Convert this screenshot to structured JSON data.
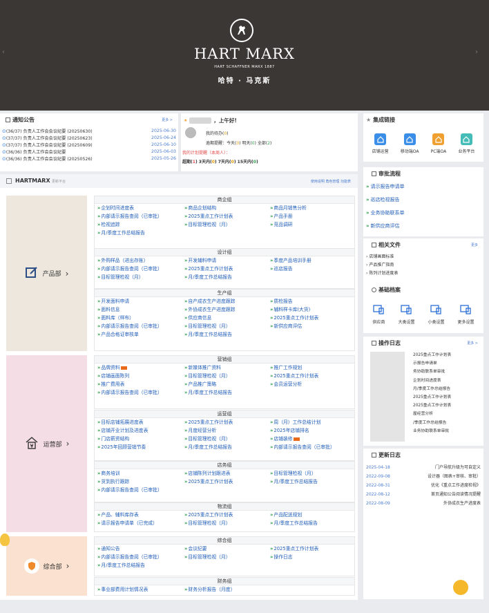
{
  "banner": {
    "brand": "HART MARX",
    "sub": "HART SCHAFFNER MARX 1887",
    "cn": "哈特 · 马克斯",
    "prev_glyph": "‹",
    "next_glyph": "›"
  },
  "notices": {
    "title": "通知公告",
    "more": "更多 >",
    "rows": [
      {
        "text": "(36/37) 负责人工作会会议纪要 (20250630)",
        "date": "2025-06-30"
      },
      {
        "text": "(37/37) 负责人工作会会议纪要 (20250623)",
        "date": "2025-06-24"
      },
      {
        "text": "(37/37) 负责人工作会会议纪要 (20250609)",
        "date": "2025-06-10"
      },
      {
        "text": "(36/36) 负责人工作会会议纪要",
        "date": "2025-06-03"
      },
      {
        "text": "(36/36) 负责人工作会会议纪要 (20250526)",
        "date": "2025-05-26"
      }
    ]
  },
  "greeting": {
    "salute": "，上午好!",
    "my_todo": "我的待办(",
    "my_todo_n": "0",
    "late_label": "逾期提醒：今天(",
    "today": "0",
    "tomorrow_label": ") 明天(",
    "tomorrow": "0",
    "all_label": ") 全部(",
    "all": "2",
    "close": ")",
    "plan_label": "我的计划提醒（本周人）：",
    "overdue_label": "超期(",
    "overdue": "1",
    "d3_label": ") 3天内(",
    "d3": "0",
    "d7_label": ") 7天内(",
    "d7": "0",
    "d15_label": ") 15天内(",
    "d15": "0"
  },
  "hartmarx": {
    "title": "HARTMARX",
    "sub": "更新平台",
    "links": "使用说明  角色管理  功能表"
  },
  "groups": {
    "product": {
      "dept": "产品部",
      "sections": [
        {
          "name": "商企组",
          "items": [
            {
              "t": "企划时间进度表"
            },
            {
              "t": "商品企划结构"
            },
            {
              "t": "商品月销售分析"
            },
            {
              "t": "内部请示报告查阅（已审批）"
            },
            {
              "t": "2025重点工作计划表"
            },
            {
              "t": "产品手册"
            },
            {
              "t": "检视追踪"
            },
            {
              "t": "目标管理检视（月）"
            },
            {
              "t": "竞品调研"
            },
            {
              "t": "月/季度工作总结报告"
            }
          ]
        },
        {
          "name": "设计组",
          "items": [
            {
              "t": "外购样品（进出存账）"
            },
            {
              "t": "开发辅料申请"
            },
            {
              "t": "季度产品培训手册"
            },
            {
              "t": "内部请示报告查阅（已审批）"
            },
            {
              "t": "2025重点工作计划表"
            },
            {
              "t": "巡店报告"
            },
            {
              "t": "目标管理检视（月）"
            },
            {
              "t": "月/季度工作总结报告"
            }
          ]
        },
        {
          "name": "生产组",
          "items": [
            {
              "t": "开发面料申请"
            },
            {
              "t": "自产成衣生产进度跟踪"
            },
            {
              "t": "质检报告"
            },
            {
              "t": "面料信息"
            },
            {
              "t": "外协成衣生产进度跟踪"
            },
            {
              "t": "辅料样卡库(大货)"
            },
            {
              "t": "面料库（样布）"
            },
            {
              "t": "供应商信息"
            },
            {
              "t": "2025重点工作计划表"
            },
            {
              "t": "内部请示报告查阅（已审批）"
            },
            {
              "t": "目标管理检视（月）"
            },
            {
              "t": "新供应商评估"
            },
            {
              "t": "产品合格证审核单"
            },
            {
              "t": "月/季度工作总结报告"
            }
          ]
        }
      ]
    },
    "ops": {
      "dept": "运营部",
      "sections": [
        {
          "name": "营销组",
          "items": [
            {
              "t": "品牌资料",
              "tag": true
            },
            {
              "t": "新媒体推广资料"
            },
            {
              "t": "推广工作规划"
            },
            {
              "t": "店铺画面陈列"
            },
            {
              "t": "目标管理检视（月）"
            },
            {
              "t": "2025重点工作计划表"
            },
            {
              "t": "推广费用表"
            },
            {
              "t": "产品推广策略"
            },
            {
              "t": "会员运营分析"
            },
            {
              "t": "内部请示报告查阅（已审批）"
            },
            {
              "t": "月/季度工作总结报告"
            }
          ]
        },
        {
          "name": "运营组",
          "items": [
            {
              "t": "目标店铺拓展进度表"
            },
            {
              "t": "2025重点工作计划表"
            },
            {
              "t": "周（月）工作总结计划"
            },
            {
              "t": "店铺开业计划及进度表"
            },
            {
              "t": "月度经营分析"
            },
            {
              "t": "2025年店铺排名"
            },
            {
              "t": "门店薪资结构"
            },
            {
              "t": "目标管理检视（月）"
            },
            {
              "t": "店铺装修",
              "tag": true
            },
            {
              "t": "2025年回顾营销节奏"
            },
            {
              "t": "月/季度工作总结报告"
            },
            {
              "t": "内部请示报告查阅（已审批）"
            }
          ]
        },
        {
          "name": "店务组",
          "items": [
            {
              "t": "商务培训"
            },
            {
              "t": "店铺陈列计划跟进表"
            },
            {
              "t": "目标管理检视（月）"
            },
            {
              "t": "货到执行跟踪"
            },
            {
              "t": "2025重点工作计划表"
            },
            {
              "t": "月/季度工作总结报告"
            },
            {
              "t": "内部请示报告查阅（已审批）"
            }
          ]
        },
        {
          "name": "物流组",
          "items": [
            {
              "t": "产品、辅料库存表"
            },
            {
              "t": "2025重点工作计划表"
            },
            {
              "t": "产品配送规划"
            },
            {
              "t": "请示报告申请单（已完成）"
            },
            {
              "t": "目标管理检视（月）"
            },
            {
              "t": "月/季度工作总结报告"
            }
          ]
        }
      ]
    },
    "general": {
      "dept": "综合部",
      "sections": [
        {
          "name": "综合组",
          "items": [
            {
              "t": "通知公告"
            },
            {
              "t": "会议纪要"
            },
            {
              "t": "2025重点工作计划表"
            },
            {
              "t": "内部请示报告查阅（已审批）"
            },
            {
              "t": "目标管理检视（月）"
            },
            {
              "t": "操作日志"
            },
            {
              "t": "月/季度工作总结报告"
            }
          ]
        },
        {
          "name": "财务组",
          "items": [
            {
              "t": "事业部费用计划情况表"
            },
            {
              "t": "财务分析报告（月度）"
            }
          ]
        }
      ]
    }
  },
  "integrated": {
    "title": "集成链接",
    "items": [
      {
        "label": "店铺运营",
        "color": "#3b8ee8"
      },
      {
        "label": "移动端OA",
        "color": "#3b8ee8"
      },
      {
        "label": "PC端OA",
        "color": "#f0a030"
      },
      {
        "label": "业务平台",
        "color": "#46bcb8"
      }
    ]
  },
  "approval": {
    "title": "审批流程",
    "items": [
      "请示报告申请单",
      "巡店检视报告",
      "业务协助联系单",
      "新供应商评估"
    ]
  },
  "files": {
    "title": "相关文件",
    "more": "更多",
    "items": [
      "店铺画面标准",
      "产品推广指南",
      "陈列计划进度表"
    ]
  },
  "archive": {
    "title": "基础档案",
    "items": [
      "供应商",
      "大类设置",
      "小类设置",
      "更多设置"
    ]
  },
  "oplog": {
    "title": "操作日志",
    "more": "更多 >",
    "rows": [
      "2025重点工作计划表",
      "示报告申请单",
      "务协助联系单审批",
      "企划时间进度表",
      "月/季度工作总结报告",
      "2025重点工作计划表",
      "2025重点工作计划表",
      "屋经营分析",
      "/季度工作总结报告",
      "业务协助联系单审批"
    ]
  },
  "updates": {
    "title": "更新日志",
    "rows": [
      {
        "date": "2025-04-18",
        "text": "门户导航升级为可自定义"
      },
      {
        "date": "2022-09-08",
        "text": "设计器（图表+审核、审批）"
      },
      {
        "date": "2022-08-31",
        "text": "优化《重点工作进度检视》"
      },
      {
        "date": "2022-08-12",
        "text": "首页通知公告阅读情况提醒"
      },
      {
        "date": "2022-08-09",
        "text": "外协成衣生产进度表"
      }
    ]
  }
}
